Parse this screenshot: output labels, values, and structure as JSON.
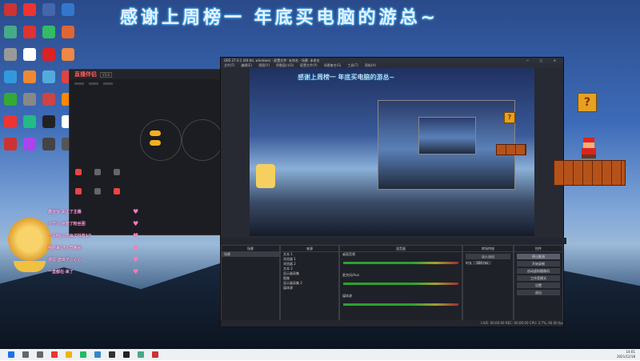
{
  "banner": "感谢上周榜一 年底买电脑的游总~",
  "colors": {
    "accent": "#ff5a5a",
    "obs_bg": "#272a33",
    "taskbar": "#eef1f4",
    "chat_glow": "#ff00aa"
  },
  "desktop_icons": [
    {
      "icon": "app-icon",
      "color": "#c33"
    },
    {
      "icon": "app-icon",
      "color": "#e33"
    },
    {
      "icon": "app-icon",
      "color": "#46a"
    },
    {
      "icon": "app-icon",
      "color": "#37c"
    },
    {
      "icon": "app-icon",
      "color": "#4a8"
    },
    {
      "icon": "app-icon",
      "color": "#d33"
    },
    {
      "icon": "app-icon",
      "color": "#3b6"
    },
    {
      "icon": "app-icon",
      "color": "#d63"
    },
    {
      "icon": "app-icon",
      "color": "#999"
    },
    {
      "icon": "app-icon",
      "color": "#fff"
    },
    {
      "icon": "app-icon",
      "color": "#d22"
    },
    {
      "icon": "app-icon",
      "color": "#e84"
    },
    {
      "icon": "app-icon",
      "color": "#39d"
    },
    {
      "icon": "app-icon",
      "color": "#e83"
    },
    {
      "icon": "app-icon",
      "color": "#5ad"
    },
    {
      "icon": "app-icon",
      "color": "#d44"
    },
    {
      "icon": "app-icon",
      "color": "#3a3"
    },
    {
      "icon": "app-icon",
      "color": "#888"
    },
    {
      "icon": "app-icon",
      "color": "#c44"
    },
    {
      "icon": "app-icon",
      "color": "#f80"
    },
    {
      "icon": "app-icon",
      "color": "#e33"
    },
    {
      "icon": "app-icon",
      "color": "#2b8"
    },
    {
      "icon": "app-icon",
      "color": "#222"
    },
    {
      "icon": "app-icon",
      "color": "#fff"
    },
    {
      "icon": "app-icon",
      "color": "#c33"
    },
    {
      "icon": "app-icon",
      "color": "#a4e"
    },
    {
      "icon": "app-icon",
      "color": "#444"
    },
    {
      "icon": "app-icon",
      "color": "#555"
    }
  ],
  "streaming_app": {
    "name": "直播伴侣",
    "version": "V3.0"
  },
  "obs": {
    "title": "OBS 27.0.1 (64-bit, windows) - 配置文件: 未命名 - 场景: 未命名",
    "menu": [
      "文件(F)",
      "编辑(E)",
      "视图(V)",
      "停靠窗口(D)",
      "配置文件(P)",
      "场景集合(S)",
      "工具(T)",
      "帮助(H)"
    ],
    "preview_banner": "感谢上周榜一 年底买电脑的游总~",
    "docks": {
      "scenes": "场景",
      "sources": "来源",
      "mixer": "混音器",
      "transitions": "转场特效",
      "controls": "控件"
    },
    "sources": [
      "文本 1",
      "浏览器 1",
      "浏览器 2",
      "文本 2",
      "显示器采集",
      "图像",
      "显示器采集 2",
      "媒体源"
    ],
    "scene_items": [
      "场景"
    ],
    "mixer_channels": [
      "桌面音频",
      "麦克风/Aux",
      "媒体源"
    ],
    "transition": {
      "name": "淡入淡出",
      "duration_label": "时长",
      "duration": "300 ms"
    },
    "control_buttons": [
      "停止推流",
      "开始录制",
      "启动虚拟摄像机",
      "工作室模式",
      "设置",
      "退出"
    ],
    "status": "LIVE: 00:00:00  REC: 00:00:00  CPU: 3.7%, 60.00 fps"
  },
  "chat": [
    "鑫宝宝·关注了主播",
    "小宁儿·点亮了粉丝团",
    "一见倾心·送出了抖音1个",
    "我刚来·进入直播间",
    "游总·送出了小心心",
    "一直都在·来了"
  ],
  "taskbar": {
    "time": "14:01",
    "date": "2021/12/18",
    "icons": [
      "windows-icon",
      "search-icon",
      "taskview-icon",
      "chrome-icon",
      "explorer-icon",
      "store-icon",
      "mail-icon",
      "obs-icon",
      "douyin-icon",
      "app-icon",
      "app-icon"
    ]
  }
}
